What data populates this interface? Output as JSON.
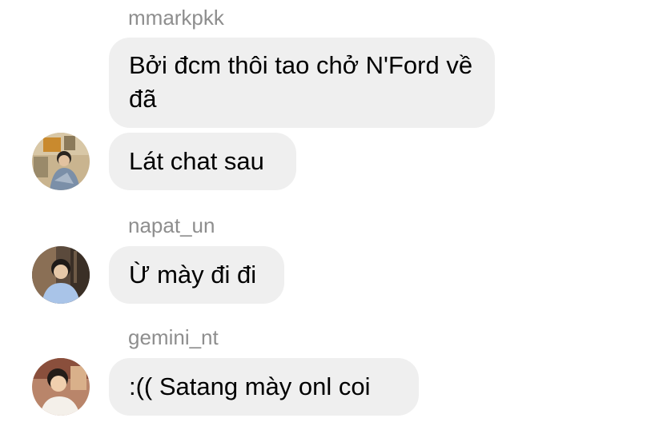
{
  "messages": [
    {
      "sender": "mmarkpkk",
      "text": "Bởi đcm thôi tao chở N'Ford về đã"
    },
    {
      "sender": "",
      "text": "Lát chat sau",
      "avatar": "user-avatar-mmarkpkk"
    },
    {
      "sender": "napat_un",
      "text": "Ừ mày đi đi",
      "avatar": "user-avatar-napat_un"
    },
    {
      "sender": "gemini_nt",
      "text": ":(( Satang mày onl coi",
      "avatar": "user-avatar-gemini_nt"
    }
  ],
  "colors": {
    "bubble": "#efefef",
    "sender_name": "#8e8e8e",
    "text": "#000000"
  }
}
